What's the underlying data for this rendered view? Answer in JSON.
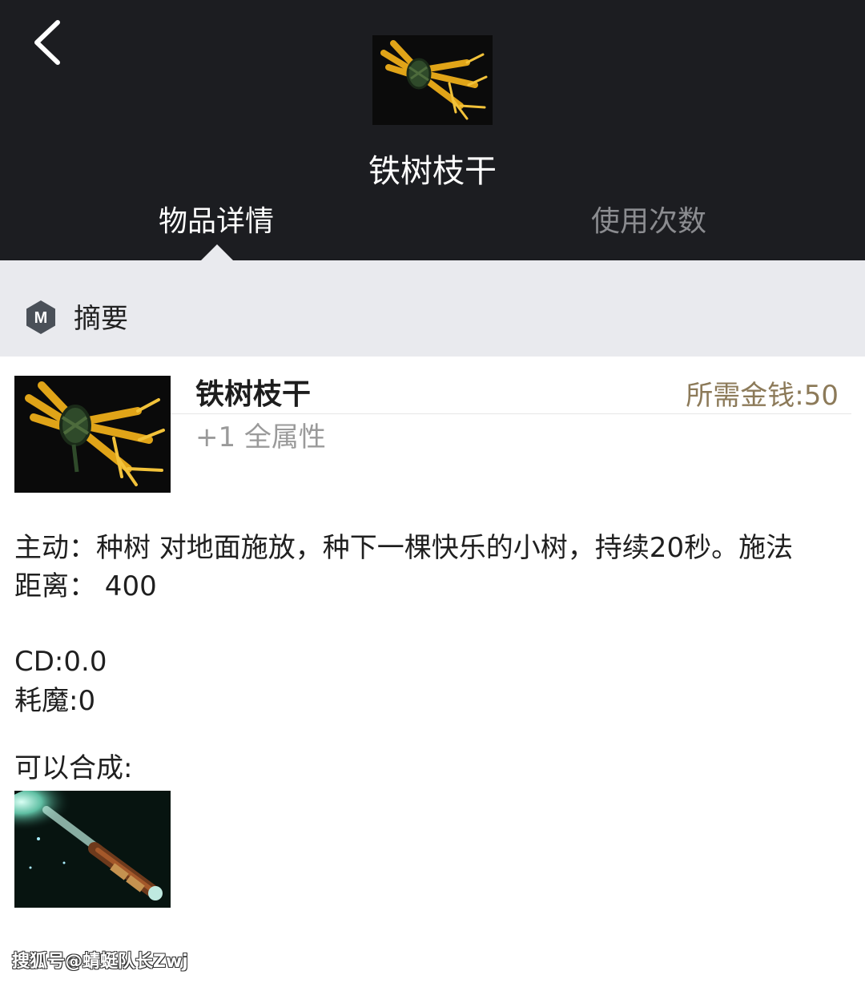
{
  "header": {
    "item_name": "铁树枝干",
    "tabs": [
      {
        "label": "物品详情",
        "active": true
      },
      {
        "label": "使用次数",
        "active": false
      }
    ]
  },
  "section": {
    "title": "摘要",
    "logo_letter": "M"
  },
  "item_card": {
    "name": "铁树枝干",
    "price": "所需金钱:50",
    "attribute": "+1 全属性"
  },
  "description": {
    "active_line1": "主动：种树 对地面施放，种下一棵快乐的小树，持续20秒。施法",
    "active_line2": "距离：  400",
    "cd": "CD:0.0",
    "mana": "耗魔:0",
    "combine_label": "可以合成:"
  },
  "watermark": "搜狐号@蜻蜓队长Zwj",
  "colors": {
    "header_bg": "#1c1d21",
    "section_bg": "#e9eaee",
    "price": "#8c7a59",
    "inactive_tab": "#8b8c90"
  },
  "icons": [
    "back-chevron-icon",
    "iron-branch-icon",
    "section-logo-icon",
    "magic-wand-icon"
  ]
}
